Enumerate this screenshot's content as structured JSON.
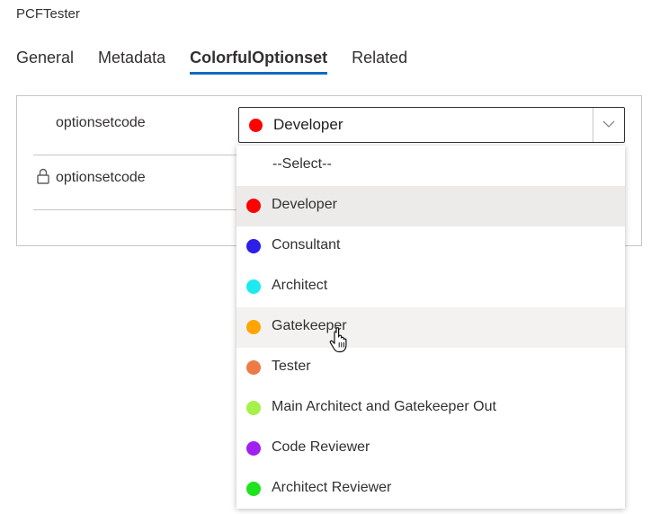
{
  "app": {
    "title": "PCFTester"
  },
  "tabs": [
    {
      "label": "General",
      "active": false
    },
    {
      "label": "Metadata",
      "active": false
    },
    {
      "label": "ColorfulOptionset",
      "active": true
    },
    {
      "label": "Related",
      "active": false
    }
  ],
  "fields": {
    "row1_label": "optionsetcode",
    "row2_label": "optionsetcode"
  },
  "select": {
    "value": "Developer",
    "color": "#ff0000"
  },
  "dropdown": {
    "placeholder": "--Select--",
    "options": [
      {
        "label": "Developer",
        "color": "#ff0000",
        "state": "selected"
      },
      {
        "label": "Consultant",
        "color": "#2d1fe6",
        "state": ""
      },
      {
        "label": "Architect",
        "color": "#1ee9f0",
        "state": ""
      },
      {
        "label": "Gatekeeper",
        "color": "#ffa500",
        "state": "hover"
      },
      {
        "label": "Tester",
        "color": "#ee7b45",
        "state": ""
      },
      {
        "label": "Main Architect and Gatekeeper Out",
        "color": "#a6f04a",
        "state": ""
      },
      {
        "label": "Code Reviewer",
        "color": "#a020f0",
        "state": ""
      },
      {
        "label": "Architect Reviewer",
        "color": "#1ee31e",
        "state": ""
      }
    ]
  },
  "colors": {
    "accent": "#0f6cbd"
  }
}
